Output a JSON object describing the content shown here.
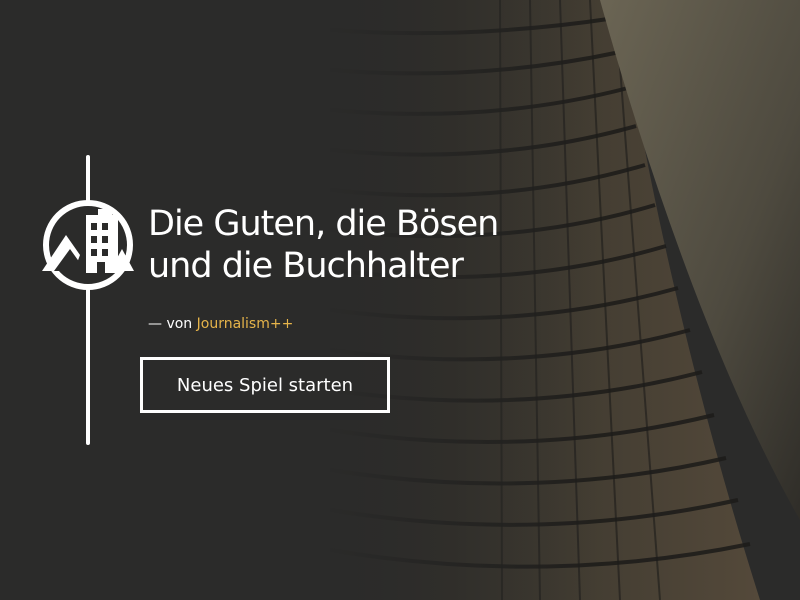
{
  "title": {
    "line1": "Die Guten, die Bösen",
    "line2": "und die Buchhalter"
  },
  "byline": {
    "prefix": "— von ",
    "author": "Journalism++"
  },
  "start_button": {
    "label": "Neues Spiel starten"
  },
  "colors": {
    "background": "#2b2b2a",
    "accent": "#e6b44a",
    "text": "#ffffff"
  },
  "icons": {
    "logo": "building-mountains-icon"
  }
}
